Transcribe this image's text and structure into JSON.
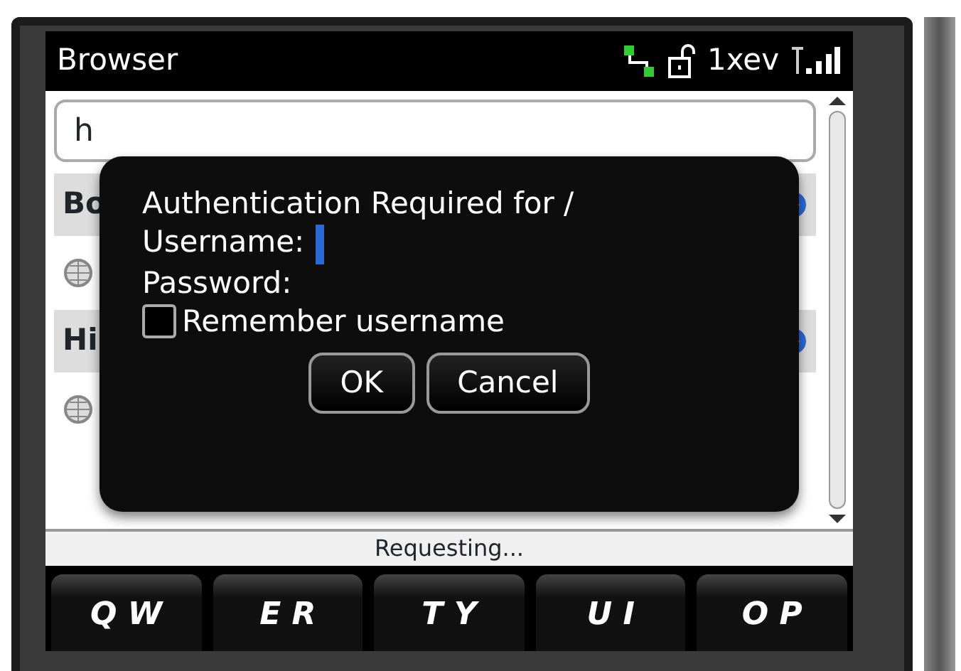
{
  "title_bar": {
    "title": "Browser",
    "network": "1xev"
  },
  "url_field": {
    "value": "h"
  },
  "sections": [
    {
      "heading": "Bo",
      "items": [
        {
          "kind": "page"
        }
      ]
    },
    {
      "heading": "Hi",
      "items": [
        {
          "kind": "page"
        }
      ]
    }
  ],
  "dialog": {
    "message": "Authentication Required for /",
    "username_label": "Username:",
    "password_label": "Password:",
    "remember": {
      "label": "Remember username",
      "checked": false
    },
    "buttons": [
      {
        "label": "OK"
      },
      {
        "label": "Cancel"
      }
    ]
  },
  "status_bar": "Requesting...",
  "keyboard": [
    "Q W",
    "E R",
    "T Y",
    "U I",
    "O P"
  ]
}
